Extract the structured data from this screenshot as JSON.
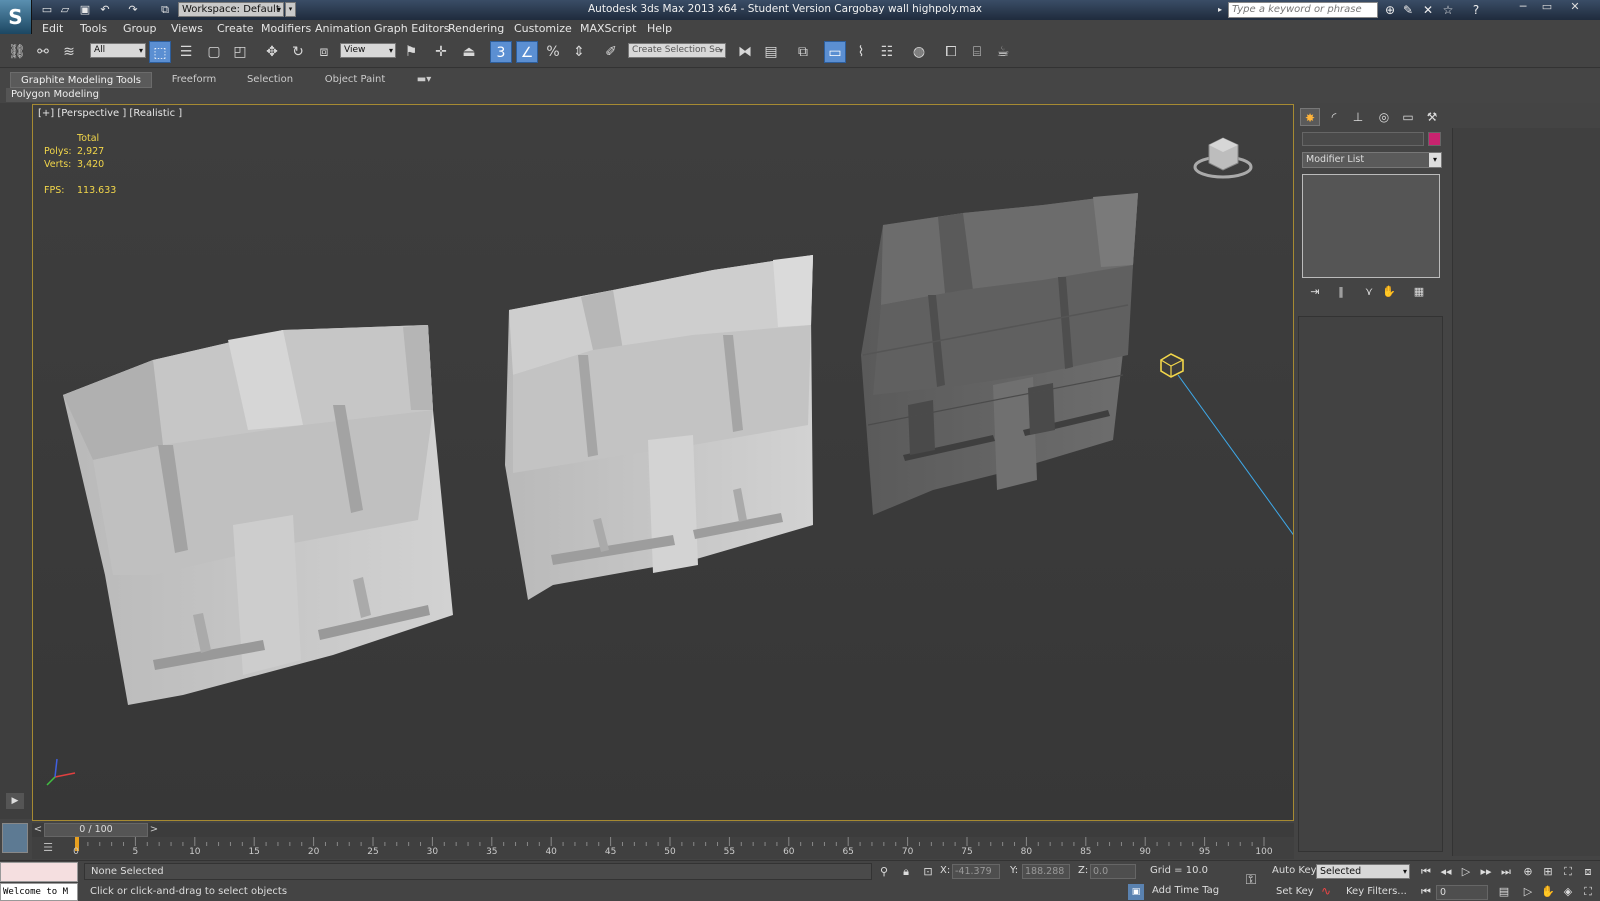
{
  "window": {
    "title": "Autodesk 3ds Max  2013 x64  - Student Version   Cargobay wall highpoly.max",
    "workspace": "Workspace: Default",
    "search_placeholder": "Type a keyword or phrase"
  },
  "menu": [
    "Edit",
    "Tools",
    "Group",
    "Views",
    "Create",
    "Modifiers",
    "Animation",
    "Graph Editors",
    "Rendering",
    "Customize",
    "MAXScript",
    "Help"
  ],
  "toolbar": {
    "selection_filter": "All",
    "ref_coord": "View",
    "named_selection": "Create Selection Se"
  },
  "ribbon": {
    "tabs": [
      "Graphite Modeling Tools",
      "Freeform",
      "Selection",
      "Object Paint"
    ],
    "active_tab": "Graphite Modeling Tools",
    "sub_panel": "Polygon Modeling"
  },
  "viewport": {
    "label": "[+] [Perspective ] [Realistic ]",
    "stats": {
      "header": "Total",
      "polys_label": "Polys:",
      "polys_value": "2,927",
      "verts_label": "Verts:",
      "verts_value": "3,420",
      "fps_label": "FPS:",
      "fps_value": "113.633"
    }
  },
  "command_panel": {
    "modifier_list": "Modifier List",
    "object_color": "#c8236f"
  },
  "time_slider": {
    "frame": "0 / 100",
    "ticks": [
      "0",
      "5",
      "10",
      "15",
      "20",
      "25",
      "30",
      "35",
      "40",
      "45",
      "50",
      "55",
      "60",
      "65",
      "70",
      "75",
      "80",
      "85",
      "90",
      "95",
      "100"
    ]
  },
  "status": {
    "selection": "None Selected",
    "prompt": "Click or click-and-drag to select objects",
    "maxscript": "Welcome to M",
    "x_label": "X:",
    "x_value": "-41.379",
    "y_label": "Y:",
    "y_value": "188.288",
    "z_label": "Z:",
    "z_value": "0.0",
    "grid": "Grid = 10.0",
    "add_time_tag": "Add Time Tag",
    "auto_key": "Auto Key",
    "set_key": "Set Key",
    "key_mode": "Selected",
    "key_filters": "Key Filters...",
    "current_frame": "0"
  }
}
